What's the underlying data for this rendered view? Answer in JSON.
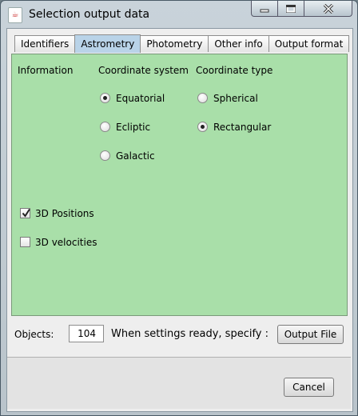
{
  "window": {
    "title": "Selection output data",
    "app_icon": "java-cup-icon"
  },
  "tabs": [
    {
      "label": "Identifiers",
      "active": false
    },
    {
      "label": "Astrometry",
      "active": true
    },
    {
      "label": "Photometry",
      "active": false
    },
    {
      "label": "Other info",
      "active": false
    },
    {
      "label": "Output format",
      "active": false
    }
  ],
  "astrometry": {
    "information_heading": "Information",
    "coord_system_heading": "Coordinate system",
    "coord_type_heading": "Coordinate type",
    "coord_system_options": [
      {
        "label": "Equatorial",
        "selected": true
      },
      {
        "label": "Ecliptic",
        "selected": false
      },
      {
        "label": "Galactic",
        "selected": false
      }
    ],
    "coord_type_options": [
      {
        "label": "Spherical",
        "selected": false
      },
      {
        "label": "Rectangular",
        "selected": true
      }
    ],
    "checkboxes": [
      {
        "label": "3D Positions",
        "checked": true
      },
      {
        "label": "3D velocities",
        "checked": false
      }
    ]
  },
  "footer": {
    "objects_label": "Objects:",
    "objects_value": "104",
    "instruction": "When settings ready, specify :",
    "output_file_button": "Output File",
    "cancel_button": "Cancel"
  },
  "colors": {
    "panel": "#a9dfa9",
    "active_tab": "#b9d3e8"
  }
}
